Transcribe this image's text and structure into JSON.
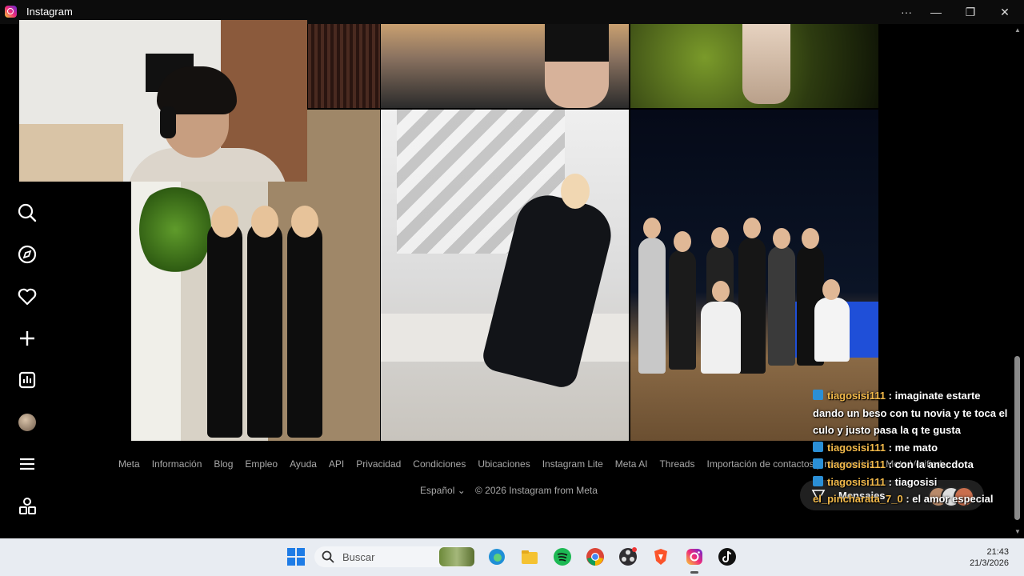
{
  "window": {
    "title": "Instagram",
    "buttons": {
      "more": "···",
      "minimize": "—",
      "restore": "❐",
      "close": "✕"
    }
  },
  "sidebar": {
    "items": [
      {
        "icon": "search-icon"
      },
      {
        "icon": "compass-icon"
      },
      {
        "icon": "heart-icon"
      },
      {
        "icon": "plus-icon"
      },
      {
        "icon": "stats-icon"
      },
      {
        "icon": "profile-avatar"
      },
      {
        "icon": "menu-icon"
      },
      {
        "icon": "apps-icon"
      }
    ]
  },
  "footer": {
    "links": [
      "Meta",
      "Información",
      "Blog",
      "Empleo",
      "Ayuda",
      "API",
      "Privacidad",
      "Condiciones",
      "Ubicaciones",
      "Instagram Lite",
      "Meta AI",
      "Threads",
      "Importación de contactos y no usuarios",
      "Meta Verified"
    ],
    "language": "Español",
    "copyright": "© 2026 Instagram from Meta"
  },
  "chat": {
    "messages": [
      {
        "user": "tiagosisi111",
        "text": ": imaginate estarte dando un beso con tu novia y te toca el culo y justo pasa la q te gusta",
        "badge": true
      },
      {
        "user": "tiagosisi111",
        "text": ": me mato",
        "badge": true
      },
      {
        "user": "tiagosisi111",
        "text": ": con la anecdota",
        "badge": true
      },
      {
        "user": "tiagosisi111",
        "text": ": tiagosisi",
        "badge": true
      },
      {
        "user": "el_pincharata_7_0",
        "text": ": el amor especial",
        "badge": false
      }
    ]
  },
  "messages_pill": {
    "label": "Mensajes"
  },
  "taskbar": {
    "search_placeholder": "Buscar",
    "time": "21:43",
    "date": "21/3/2026",
    "apps": [
      "start-icon",
      "search-icon",
      "edge-icon",
      "file-explorer-icon",
      "spotify-icon",
      "chrome-icon",
      "obs-icon",
      "brave-icon",
      "instagram-icon",
      "tiktok-icon"
    ]
  },
  "colors": {
    "background": "#000000",
    "username": "#f2b94a",
    "link_text": "#a8a8a8",
    "taskbar": "#e8ecf2"
  }
}
